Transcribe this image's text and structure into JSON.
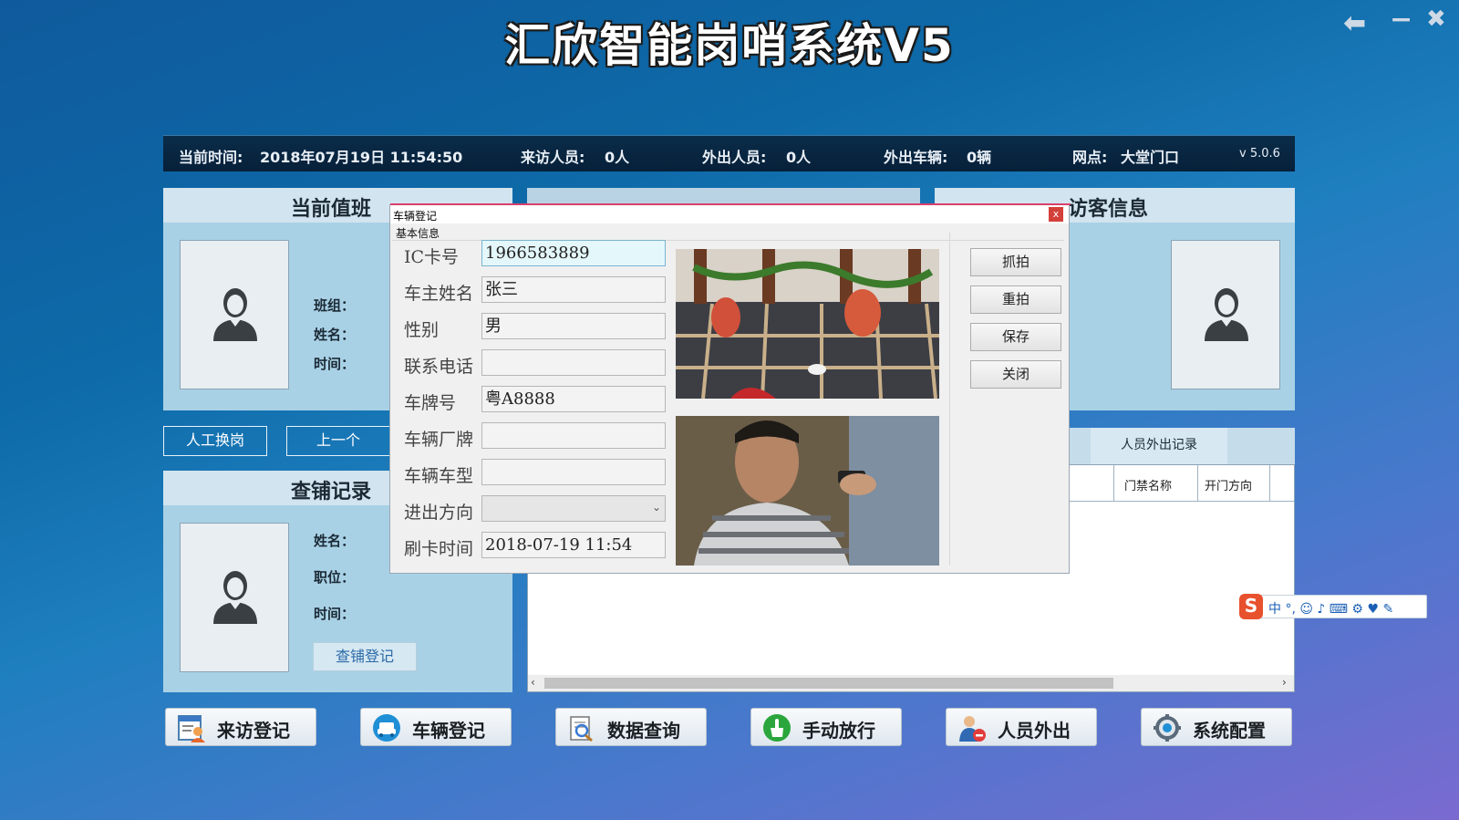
{
  "app": {
    "title": "汇欣智能岗哨系统V5",
    "window_controls": {
      "back": "⬅",
      "minimize": "−",
      "close": "✖"
    }
  },
  "status": {
    "time_label": "当前时间:",
    "time_value": "2018年07月19日 11:54:50",
    "visitors_label": "来访人员:",
    "visitors_value": "0人",
    "out_persons_label": "外出人员:",
    "out_persons_value": "0人",
    "out_vehicles_label": "外出车辆:",
    "out_vehicles_value": "0辆",
    "site_label": "网点:",
    "site_value": "大堂门口",
    "version": "v 5.0.6"
  },
  "duty_panel": {
    "title": "当前值班",
    "fields": [
      "班组：",
      "姓名：",
      "时间："
    ],
    "buttons": [
      "人工换岗",
      "上一个"
    ]
  },
  "check_panel": {
    "title": "查铺记录",
    "fields": [
      "姓名：",
      "职位：",
      "时间："
    ],
    "button": "查铺登记"
  },
  "visitor_panel": {
    "title": "访客信息"
  },
  "records": {
    "tab": "人员外出记录",
    "columns": [
      "门禁名称",
      "开门方向"
    ]
  },
  "bottom_buttons": [
    {
      "label": "来访登记",
      "icon": "visitor-register-icon"
    },
    {
      "label": "车辆登记",
      "icon": "vehicle-register-icon"
    },
    {
      "label": "数据查询",
      "icon": "data-query-icon"
    },
    {
      "label": "手动放行",
      "icon": "manual-release-icon"
    },
    {
      "label": "人员外出",
      "icon": "person-exit-icon"
    },
    {
      "label": "系统配置",
      "icon": "system-config-icon"
    }
  ],
  "dialog": {
    "title": "车辆登记",
    "group": "基本信息",
    "fields": [
      {
        "label": "IC卡号",
        "value": "1966583889"
      },
      {
        "label": "车主姓名",
        "value": "张三"
      },
      {
        "label": "性别",
        "value": "男"
      },
      {
        "label": "联系电话",
        "value": ""
      },
      {
        "label": "车牌号",
        "value": "粤A8888"
      },
      {
        "label": "车辆厂牌",
        "value": ""
      },
      {
        "label": "车辆车型",
        "value": ""
      },
      {
        "label": "进出方向",
        "value": ""
      },
      {
        "label": "刷卡时间",
        "value": "2018-07-19 11:54"
      }
    ],
    "buttons": [
      "抓拍",
      "重拍",
      "保存",
      "关闭"
    ],
    "close": "x"
  },
  "ime": {
    "glyphs": "中 °, ☺ ♪ ⌨ ⚙ ♥ ✎",
    "logo": "S"
  }
}
